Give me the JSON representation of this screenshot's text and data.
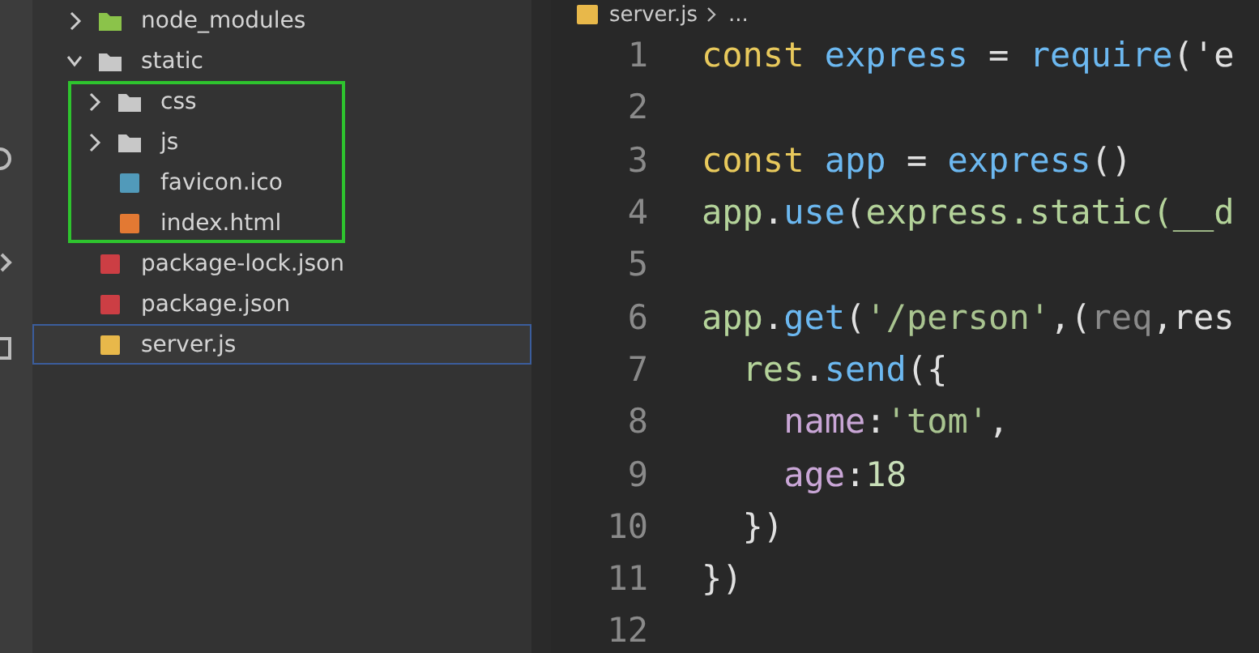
{
  "explorer": {
    "items": [
      {
        "label": "node_modules",
        "kind": "node-folder",
        "expanded": false,
        "selected": false
      },
      {
        "label": "static",
        "kind": "folder",
        "expanded": true,
        "selected": false,
        "highlight": true,
        "children": [
          {
            "label": "css",
            "kind": "folder",
            "expanded": false,
            "selected": false
          },
          {
            "label": "js",
            "kind": "folder",
            "expanded": false,
            "selected": false
          },
          {
            "label": "favicon.ico",
            "kind": "image",
            "selected": false
          },
          {
            "label": "index.html",
            "kind": "html",
            "selected": false
          }
        ]
      },
      {
        "label": "package-lock.json",
        "kind": "json",
        "selected": false
      },
      {
        "label": "package.json",
        "kind": "json",
        "selected": false
      },
      {
        "label": "server.js",
        "kind": "js",
        "selected": true
      }
    ]
  },
  "breadcrumb": {
    "file": "server.js",
    "trail": "..."
  },
  "editor": {
    "lines": [
      {
        "number": "1",
        "tokens": [
          {
            "text": "const ",
            "kind": "keyword"
          },
          {
            "text": "express",
            "kind": "variable"
          },
          {
            "text": " = ",
            "kind": "plain"
          },
          {
            "text": "require",
            "kind": "variable"
          },
          {
            "text": "('e",
            "kind": "plain"
          }
        ]
      },
      {
        "number": "2"
      },
      {
        "number": "3",
        "tokens": [
          {
            "text": "const ",
            "kind": "keyword"
          },
          {
            "text": "app",
            "kind": "variable"
          },
          {
            "text": " = ",
            "kind": "plain"
          },
          {
            "text": "express",
            "kind": "variable"
          },
          {
            "text": "()",
            "kind": "plain"
          }
        ]
      },
      {
        "number": "4",
        "tokens": [
          {
            "text": "app",
            "kind": "object"
          },
          {
            "text": ".",
            "kind": "plain"
          },
          {
            "text": "use",
            "kind": "variable"
          },
          {
            "text": "(",
            "kind": "plain"
          },
          {
            "text": "express.static(__d",
            "kind": "object"
          }
        ]
      },
      {
        "number": "5"
      },
      {
        "number": "6",
        "tokens": [
          {
            "text": "app",
            "kind": "object"
          },
          {
            "text": ".",
            "kind": "plain"
          },
          {
            "text": "get",
            "kind": "variable"
          },
          {
            "text": "(",
            "kind": "plain"
          },
          {
            "text": "'/person'",
            "kind": "string"
          },
          {
            "text": ",(",
            "kind": "plain"
          },
          {
            "text": "req",
            "kind": "param"
          },
          {
            "text": ",res",
            "kind": "plain"
          }
        ]
      },
      {
        "number": "7",
        "tokens": [
          {
            "text": "  res",
            "kind": "object"
          },
          {
            "text": ".",
            "kind": "plain"
          },
          {
            "text": "send",
            "kind": "variable"
          },
          {
            "text": "({",
            "kind": "plain"
          }
        ]
      },
      {
        "number": "8",
        "tokens": [
          {
            "text": "    name",
            "kind": "property"
          },
          {
            "text": ":",
            "kind": "plain"
          },
          {
            "text": "'tom'",
            "kind": "string"
          },
          {
            "text": ",",
            "kind": "plain"
          }
        ]
      },
      {
        "number": "9",
        "tokens": [
          {
            "text": "    age",
            "kind": "property"
          },
          {
            "text": ":",
            "kind": "plain"
          },
          {
            "text": "18",
            "kind": "number"
          }
        ]
      },
      {
        "number": "10",
        "tokens": [
          {
            "text": "  })",
            "kind": "plain"
          }
        ]
      },
      {
        "number": "11",
        "tokens": [
          {
            "text": "})",
            "kind": "plain"
          }
        ]
      },
      {
        "number": "12"
      }
    ]
  }
}
